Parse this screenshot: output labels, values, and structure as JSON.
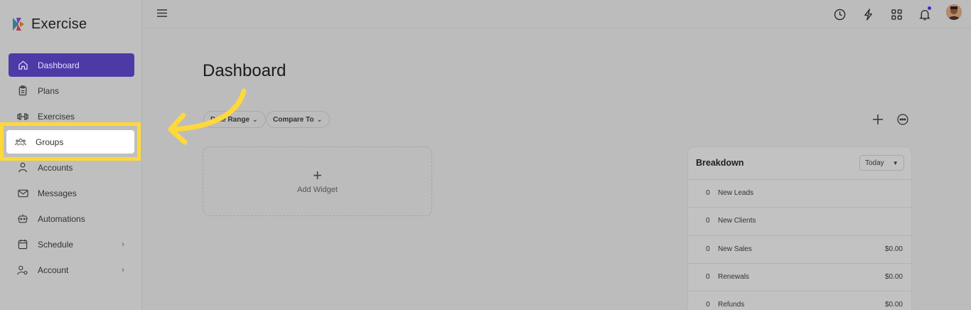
{
  "app": {
    "name": "Exercise"
  },
  "sidebar": {
    "items": [
      {
        "label": "Dashboard",
        "icon": "home-icon",
        "active": true
      },
      {
        "label": "Plans",
        "icon": "clipboard-icon"
      },
      {
        "label": "Exercises",
        "icon": "dumbbell-icon"
      },
      {
        "label": "Groups",
        "icon": "users-icon",
        "highlighted": true
      },
      {
        "label": "Accounts",
        "icon": "user-icon"
      },
      {
        "label": "Messages",
        "icon": "mail-icon"
      },
      {
        "label": "Automations",
        "icon": "robot-icon"
      },
      {
        "label": "Schedule",
        "icon": "calendar-icon",
        "has_submenu": true
      },
      {
        "label": "Account",
        "icon": "user-gear-icon",
        "has_submenu": true
      }
    ]
  },
  "topbar": {
    "icons": [
      "clock-icon",
      "lightning-icon",
      "apps-grid-icon",
      "bell-icon",
      "avatar"
    ]
  },
  "main": {
    "title": "Dashboard",
    "filters": [
      {
        "label": "Date Range"
      },
      {
        "label": "Compare To"
      }
    ],
    "add_widget_label": "Add Widget"
  },
  "breakdown": {
    "title": "Breakdown",
    "period": "Today",
    "rows": [
      {
        "count": "0",
        "label": "New Leads",
        "value": ""
      },
      {
        "count": "0",
        "label": "New Clients",
        "value": ""
      },
      {
        "count": "0",
        "label": "New Sales",
        "value": "$0.00"
      },
      {
        "count": "0",
        "label": "Renewals",
        "value": "$0.00"
      },
      {
        "count": "0",
        "label": "Refunds",
        "value": "$0.00"
      }
    ]
  },
  "colors": {
    "accent": "#4e3aa6",
    "highlight": "#ffd83a",
    "arrow": "#ffd83a"
  }
}
